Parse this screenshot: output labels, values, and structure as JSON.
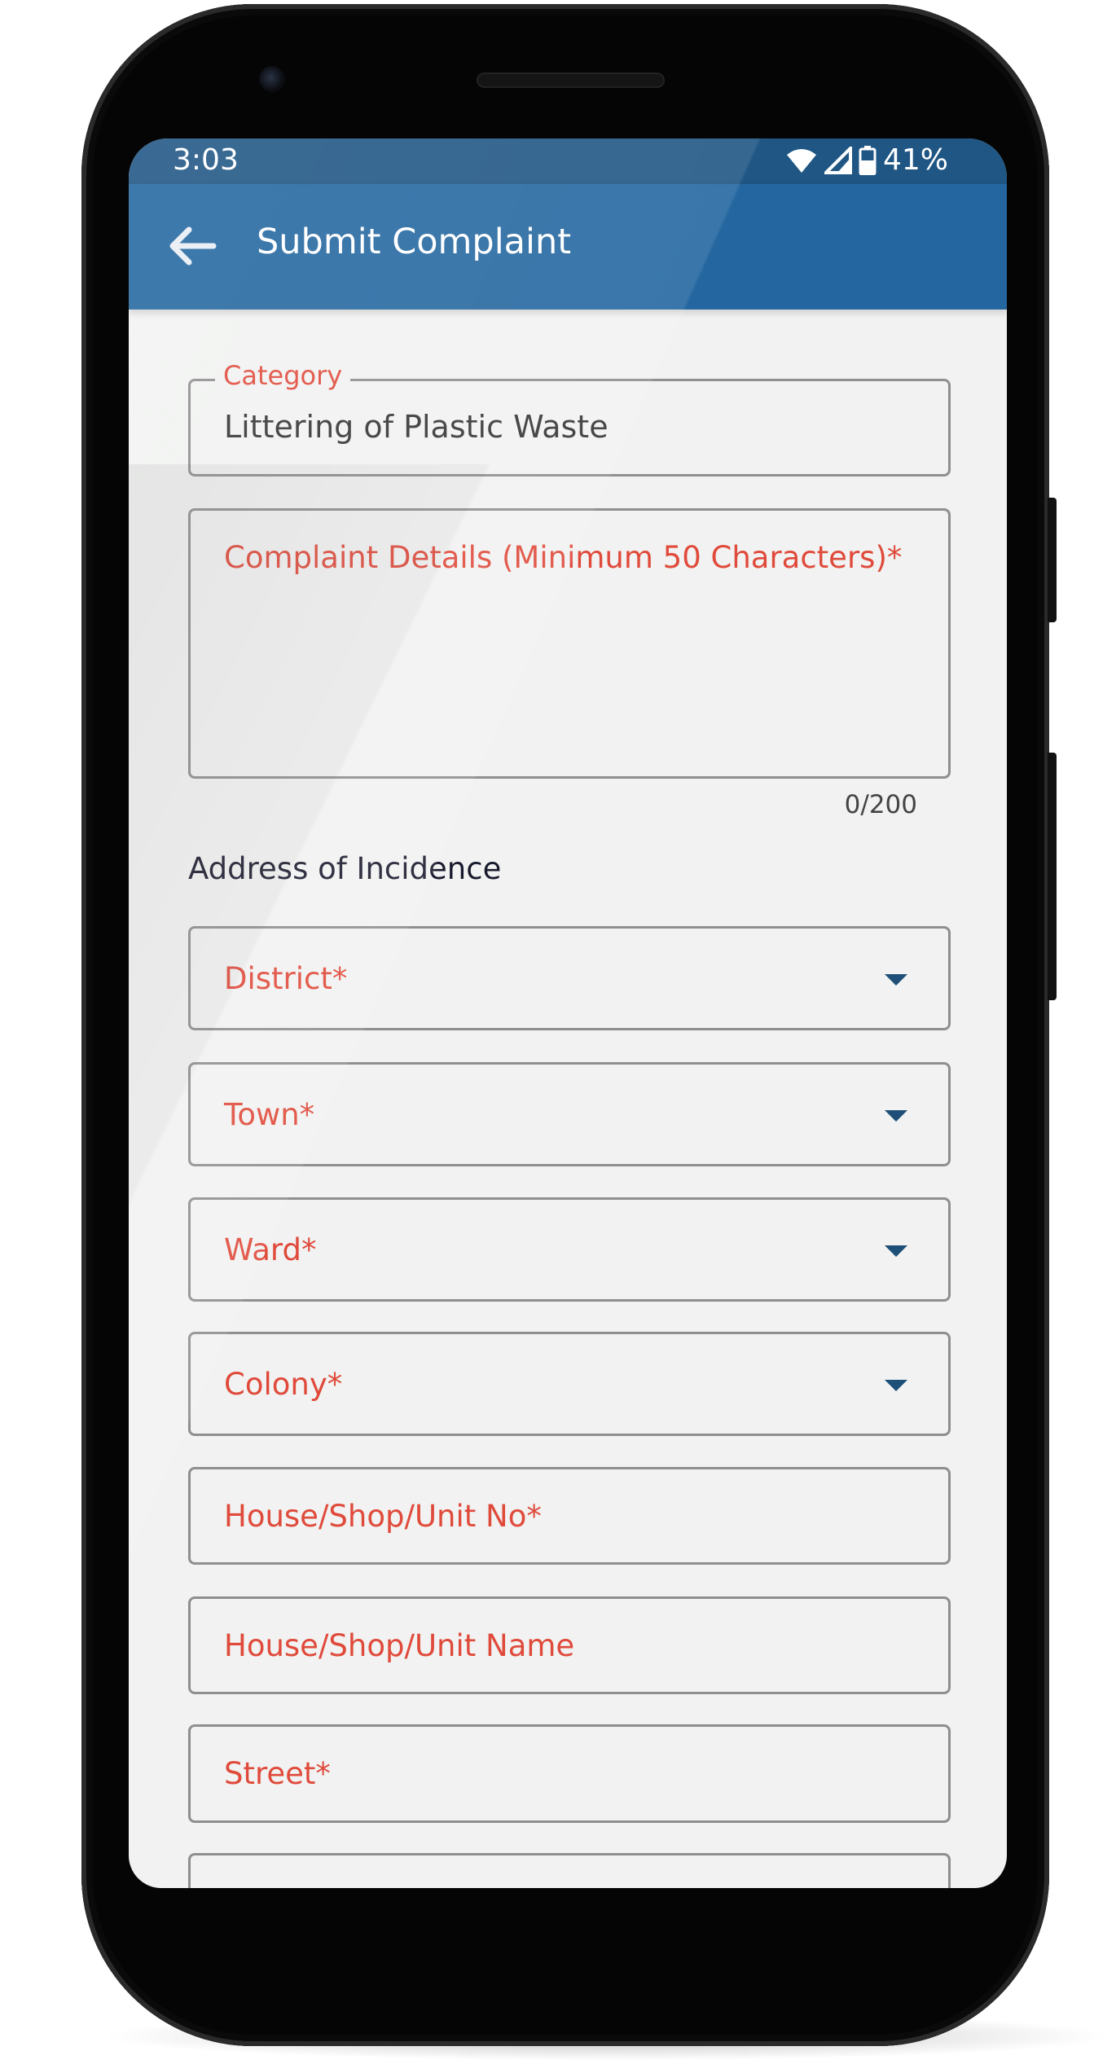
{
  "status_bar": {
    "time": "3:03",
    "battery": "41%",
    "icons": [
      "wifi-icon",
      "signal-icon",
      "battery-icon"
    ]
  },
  "app_bar": {
    "title": "Submit Complaint",
    "back_icon": "arrow-left-icon"
  },
  "form": {
    "category": {
      "label": "Category",
      "value": "Littering of Plastic Waste"
    },
    "details": {
      "placeholder": "Complaint Details (Minimum 50 Characters)*",
      "counter": "0/200"
    },
    "address_heading": "Address of Incidence",
    "dropdowns": [
      {
        "label": "District*"
      },
      {
        "label": "Town*"
      },
      {
        "label": "Ward*"
      },
      {
        "label": "Colony*"
      }
    ],
    "inputs": [
      {
        "label": "House/Shop/Unit No*"
      },
      {
        "label": "House/Shop/Unit Name"
      },
      {
        "label": "Street*"
      }
    ]
  },
  "colors": {
    "app_bar": "#2467a0",
    "status_bar": "#1f5684",
    "label": "#e04a3b",
    "background": "#f1f2f1"
  }
}
